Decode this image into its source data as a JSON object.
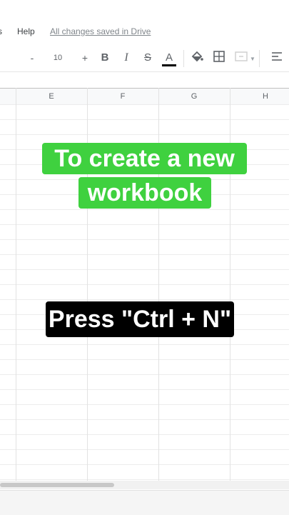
{
  "menu": {
    "partial_item": "s",
    "help": "Help",
    "save_status": "All changes saved in Drive"
  },
  "toolbar": {
    "decrease": "-",
    "font_size": "10",
    "increase": "+",
    "bold": "B",
    "italic": "I",
    "strikethrough": "S",
    "text_color": "A",
    "fill_icon": "paint-bucket-icon",
    "borders_icon": "borders-icon",
    "merge_icon": "merge-cells-icon",
    "align_icon": "align-left-icon",
    "text_color_value": "#000000"
  },
  "columns": [
    "E",
    "F",
    "G",
    "H"
  ],
  "overlay": {
    "line1": "To create a new",
    "line2": "workbook",
    "shortcut": "Press \"Ctrl + N\"",
    "green": "#3fd13f",
    "black": "#000000"
  }
}
